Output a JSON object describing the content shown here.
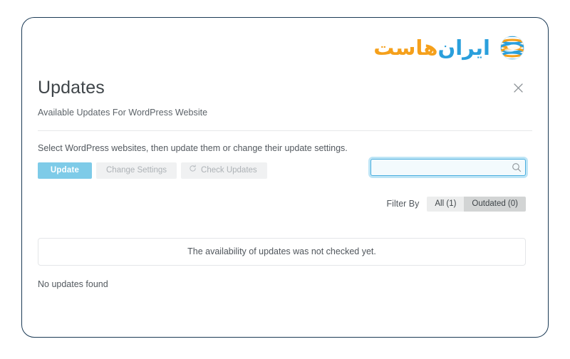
{
  "brand": {
    "wordmark_iran": "ایران",
    "wordmark_host": "هاست",
    "globe_icon": "globe-sphere-icon",
    "color_blue": "#2a9fdc",
    "color_orange": "#f5a01b"
  },
  "panel": {
    "title": "Updates",
    "subtitle": "Available Updates For WordPress Website",
    "close_icon": "close-icon",
    "instructions": "Select WordPress websites, then update them or change their update settings."
  },
  "toolbar": {
    "update_label": "Update",
    "change_settings_label": "Change Settings",
    "check_updates_label": "Check Updates",
    "check_updates_icon": "refresh-icon",
    "primary_color": "#7ecbe8"
  },
  "search": {
    "value": "",
    "placeholder": "",
    "icon": "search-icon"
  },
  "filter": {
    "label": "Filter By",
    "options": [
      {
        "label": "All (1)",
        "selected": false
      },
      {
        "label": "Outdated (0)",
        "selected": true
      }
    ]
  },
  "notice": {
    "message": "The availability of updates was not checked yet."
  },
  "results": {
    "empty_message": "No updates found"
  }
}
